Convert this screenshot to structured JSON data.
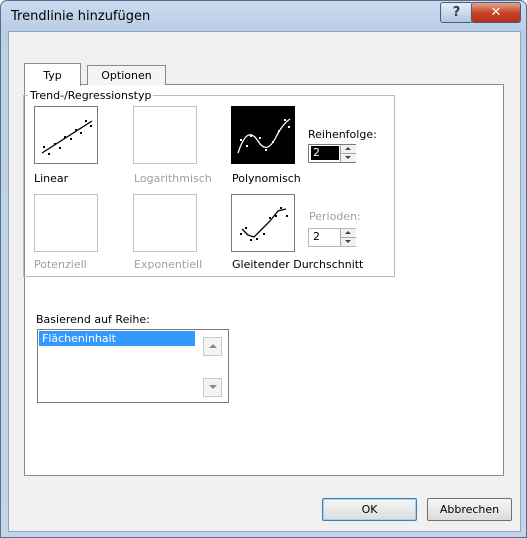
{
  "window": {
    "title": "Trendlinie hinzufügen",
    "help_label": "?",
    "close_label": "✕"
  },
  "tabs": [
    {
      "label": "Typ",
      "active": true
    },
    {
      "label": "Optionen",
      "active": false
    }
  ],
  "trend_group": {
    "label": "Trend-/Regressionstyp",
    "types": [
      {
        "label": "Linear",
        "enabled": true,
        "selected": false,
        "icon": "linear-trend-icon"
      },
      {
        "label": "Logarithmisch",
        "enabled": false,
        "selected": false,
        "icon": "logarithmic-trend-icon"
      },
      {
        "label": "Polynomisch",
        "enabled": true,
        "selected": true,
        "icon": "polynomial-trend-icon"
      },
      {
        "label": "Potenziell",
        "enabled": false,
        "selected": false,
        "icon": "power-trend-icon"
      },
      {
        "label": "Exponentiell",
        "enabled": false,
        "selected": false,
        "icon": "exponential-trend-icon"
      },
      {
        "label": "Gleitender Durchschnitt",
        "enabled": true,
        "selected": false,
        "icon": "moving-average-icon"
      }
    ],
    "order": {
      "label": "Reihenfolge:",
      "value": "2"
    },
    "periods": {
      "label": "Perioden:",
      "value": "2"
    }
  },
  "series": {
    "label": "Basierend auf Reihe:",
    "items": [
      "Flächeninhalt"
    ]
  },
  "buttons": {
    "ok": "OK",
    "cancel": "Abbrechen"
  },
  "colors": {
    "selection": "#3399ff",
    "title_bar": "#c9dbef",
    "close_button": "#c8452b"
  }
}
